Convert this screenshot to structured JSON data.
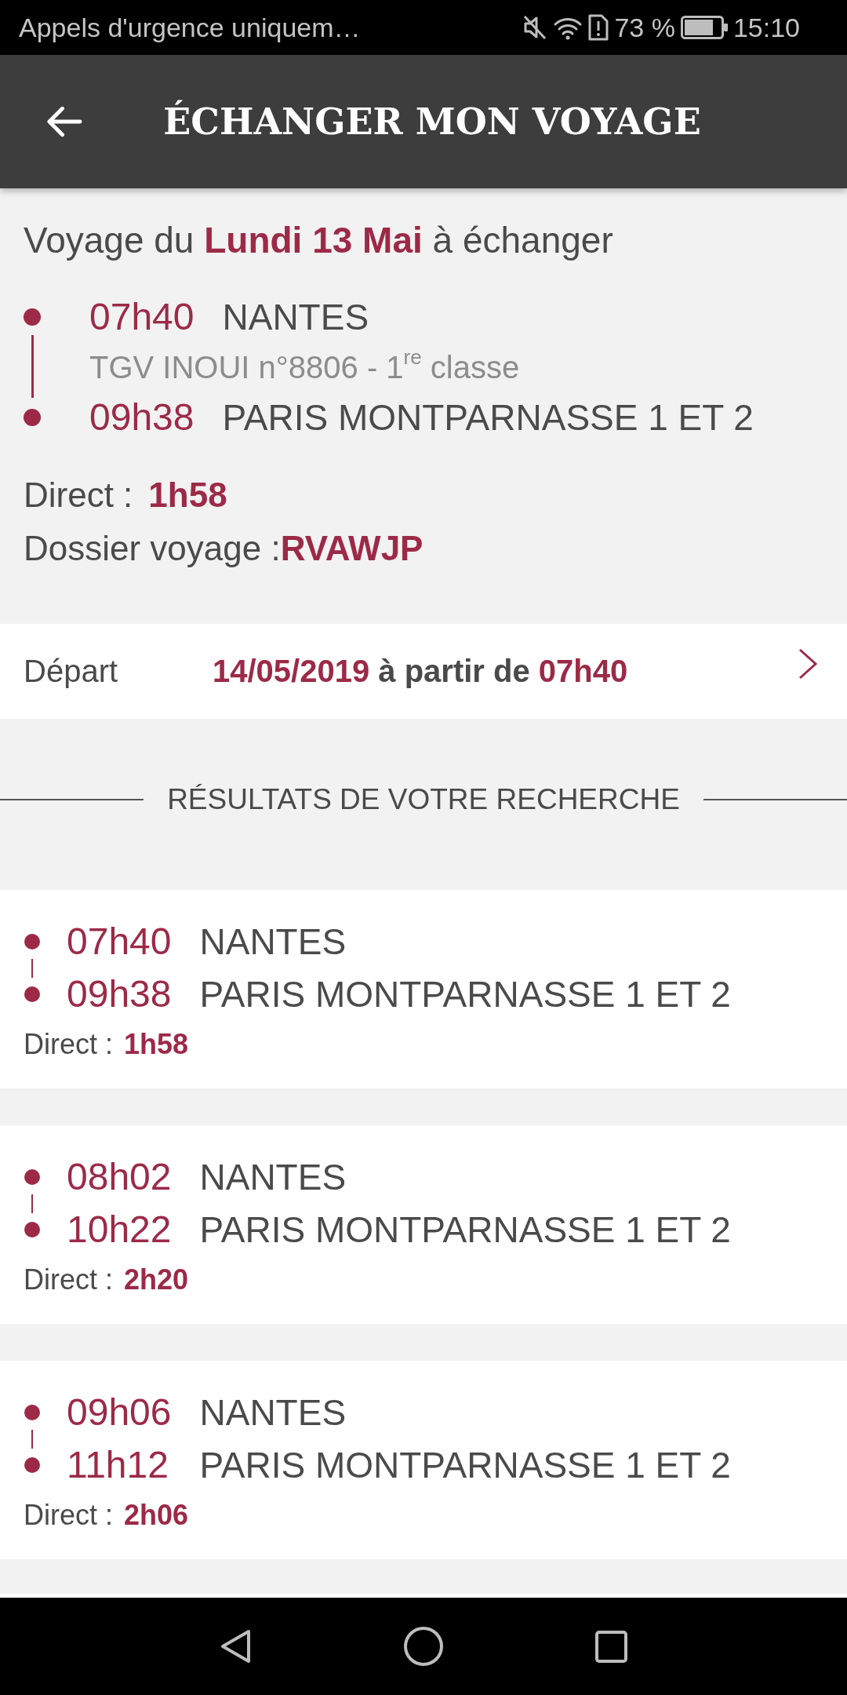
{
  "status_bar": {
    "notification": "Appels d'urgence uniquem…",
    "battery_percent": "73 %",
    "time": "15:10"
  },
  "app_bar": {
    "title": "ÉCHANGER MON VOYAGE"
  },
  "trip": {
    "heading": "Voyage du **Lundi 13 Mai** à échanger",
    "stops": [
      {
        "time": "07h40",
        "station": "NANTES"
      },
      {
        "time": "09h38",
        "station": "PARIS MONTPARNASSE 1 ET 2"
      }
    ],
    "train": "TGV INOUI n°8806 - 1$^{re}$ classe",
    "direct_label": "Direct :",
    "duration": "1h58",
    "file_label": "Dossier voyage :",
    "file_reference": "RVAWJP"
  },
  "departure": {
    "label": "Départ",
    "date": "14/05/2019",
    "connector": "à partir de",
    "time": "07h40"
  },
  "results": {
    "title": "RÉSULTATS DE VOTRE RECHERCHE",
    "items": [
      {
        "stops": [
          {
            "time": "07h40",
            "station": "NANTES"
          },
          {
            "time": "09h38",
            "station": "PARIS MONTPARNASSE 1 ET 2"
          }
        ],
        "direct_label": "Direct :",
        "duration": "1h58"
      },
      {
        "stops": [
          {
            "time": "08h02",
            "station": "NANTES"
          },
          {
            "time": "10h22",
            "station": "PARIS MONTPARNASSE 1 ET 2"
          }
        ],
        "direct_label": "Direct :",
        "duration": "2h20"
      },
      {
        "stops": [
          {
            "time": "09h06",
            "station": "NANTES"
          },
          {
            "time": "11h12",
            "station": "PARIS MONTPARNASSE 1 ET 2"
          }
        ],
        "direct_label": "Direct :",
        "duration": "2h06"
      }
    ]
  }
}
